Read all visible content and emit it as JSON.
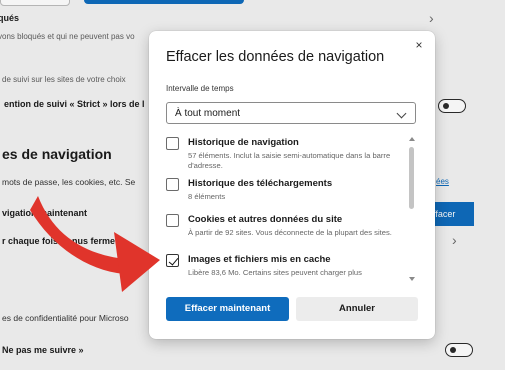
{
  "background": {
    "row1_title": "qués",
    "row1_sub": "vons bloqués et qui ne peuvent pas vo",
    "row2_sub": "de suivi sur les sites de votre choix",
    "row3_text": "ention de suivi « Strict » lors de l",
    "section_heading": "es de navigation",
    "section_sub": "mots de passe, les cookies, etc. Se",
    "link_text": "ées",
    "row_now": "vigation maintenant",
    "side_button": "ffacer",
    "row_each": "r chaque fois … nus ferme le",
    "privacy_text": "es de confidentialité pour Microso",
    "dnt_text": "Ne pas me suivre »"
  },
  "dialog": {
    "title": "Effacer les données de navigation",
    "close_symbol": "×",
    "range_label": "Intervalle de temps",
    "range_value": "À tout moment",
    "items": [
      {
        "title": "Historique de navigation",
        "desc": "57 éléments. Inclut la saisie semi-automatique dans la barre d'adresse.",
        "checked": false
      },
      {
        "title": "Historique des téléchargements",
        "desc": "8 éléments",
        "checked": false
      },
      {
        "title": "Cookies et autres données du site",
        "desc": "À partir de 92 sites. Vous déconnecte de la plupart des sites.",
        "checked": false
      },
      {
        "title": "Images et fichiers mis en cache",
        "desc": "Libère 83,6 Mo. Certains sites peuvent charger plus",
        "checked": true
      }
    ],
    "primary_button": "Effacer maintenant",
    "secondary_button": "Annuler"
  },
  "colors": {
    "accent": "#0f6cbd",
    "arrow": "#e0342b"
  }
}
